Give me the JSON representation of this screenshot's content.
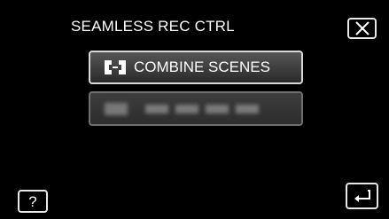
{
  "screen": {
    "title": "SEAMLESS REC CTRL"
  },
  "menu": {
    "combine_label": "COMBINE SCENES",
    "combine_icon": "combine-scenes-icon",
    "second_item": "disabled"
  },
  "buttons": {
    "help_label": "?",
    "close_icon": "close-icon",
    "return_icon": "return-icon"
  }
}
